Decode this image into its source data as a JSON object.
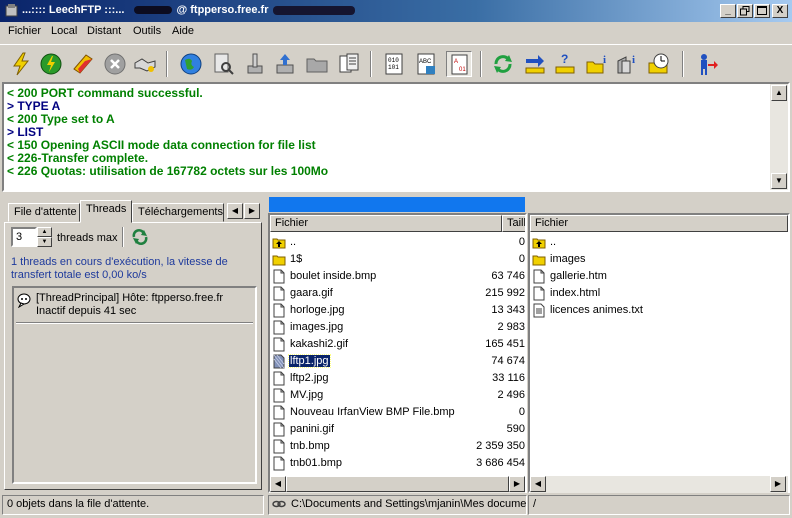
{
  "window": {
    "title": "...:::: LeechFTP :::...",
    "host": "@ ftpperso.free.fr",
    "buttons": {
      "minimize": "_",
      "restore": "▫",
      "close": "X"
    }
  },
  "menu": [
    "Fichier",
    "Local",
    "Distant",
    "Outils",
    "Aide"
  ],
  "toolbar_icons": [
    "connect-icon",
    "quick-connect-icon",
    "bookmark-icon",
    "disconnect-icon",
    "handshake-icon",
    "globe-icon",
    "file-search-icon",
    "hand-icon",
    "upload-icon",
    "folder-icon",
    "document-icon",
    "binary-mode-icon",
    "ascii-mode-icon",
    "auto-mode-icon",
    "refresh-icon",
    "transfer-icon",
    "help-icon",
    "folder-info-icon",
    "file-info-icon",
    "scheduler-icon",
    "exit-icon"
  ],
  "log": [
    {
      "text": "< 200 PORT command successful.",
      "color": "#008000"
    },
    {
      "text": "> TYPE A",
      "color": "#000080"
    },
    {
      "text": "< 200 Type set to A",
      "color": "#008000"
    },
    {
      "text": "> LIST",
      "color": "#000080"
    },
    {
      "text": "< 150 Opening ASCII mode data connection for file list",
      "color": "#008000"
    },
    {
      "text": "< 226-Transfer complete.",
      "color": "#008000"
    },
    {
      "text": "< 226 Quotas: utilisation de 167782 octets sur les 100Mo",
      "color": "#008000"
    }
  ],
  "tabs": [
    "File d'attente",
    "Threads",
    "Téléchargements"
  ],
  "threads": {
    "count": "3",
    "label": "threads max",
    "info": "1 threads en cours d'exécution, la vitesse de transfert totale est 0,00 ko/s",
    "items": [
      {
        "line1": "[ThreadPrincipal] Hôte: ftpperso.free.fr",
        "line2": "Inactif depuis 41 sec"
      }
    ]
  },
  "local": {
    "col_name": "Fichier",
    "col_size": "Taille",
    "files": [
      {
        "name": "..",
        "size": "0",
        "icon": "up-folder-icon"
      },
      {
        "name": "1$",
        "size": "0",
        "icon": "folder-icon"
      },
      {
        "name": "boulet inside.bmp",
        "size": "63 746",
        "icon": "file-icon"
      },
      {
        "name": "gaara.gif",
        "size": "215 992",
        "icon": "file-icon"
      },
      {
        "name": "horloge.jpg",
        "size": "13 343",
        "icon": "file-icon"
      },
      {
        "name": "images.jpg",
        "size": "2 983",
        "icon": "file-icon"
      },
      {
        "name": "kakashi2.gif",
        "size": "165 451",
        "icon": "file-icon"
      },
      {
        "name": "lftp1.jpg",
        "size": "74 674",
        "icon": "file-selected-icon",
        "selected": true
      },
      {
        "name": "lftp2.jpg",
        "size": "33 116",
        "icon": "file-icon"
      },
      {
        "name": "MV.jpg",
        "size": "2 496",
        "icon": "file-icon"
      },
      {
        "name": "Nouveau IrfanView BMP File.bmp",
        "size": "0",
        "icon": "file-icon"
      },
      {
        "name": "panini.gif",
        "size": "590",
        "icon": "file-icon"
      },
      {
        "name": "tnb.bmp",
        "size": "2 359 350",
        "icon": "file-icon"
      },
      {
        "name": "tnb01.bmp",
        "size": "3 686 454",
        "icon": "file-icon"
      }
    ]
  },
  "remote": {
    "col_name": "Fichier",
    "files": [
      {
        "name": "..",
        "icon": "up-folder-icon"
      },
      {
        "name": "images",
        "icon": "folder-icon"
      },
      {
        "name": "gallerie.htm",
        "icon": "file-icon"
      },
      {
        "name": "index.html",
        "icon": "file-icon"
      },
      {
        "name": "licences animes.txt",
        "icon": "text-file-icon"
      }
    ]
  },
  "status": {
    "queue": "0 objets dans la file d'attente.",
    "local_path": "C:\\Documents and Settings\\mjanin\\Mes documents",
    "remote_path": "/"
  },
  "colors": {
    "title_start": "#0a246a",
    "title_end": "#a6caf0",
    "progress": "#1177ee",
    "selection": "#0a246a",
    "info_text": "#1e3a9c"
  }
}
